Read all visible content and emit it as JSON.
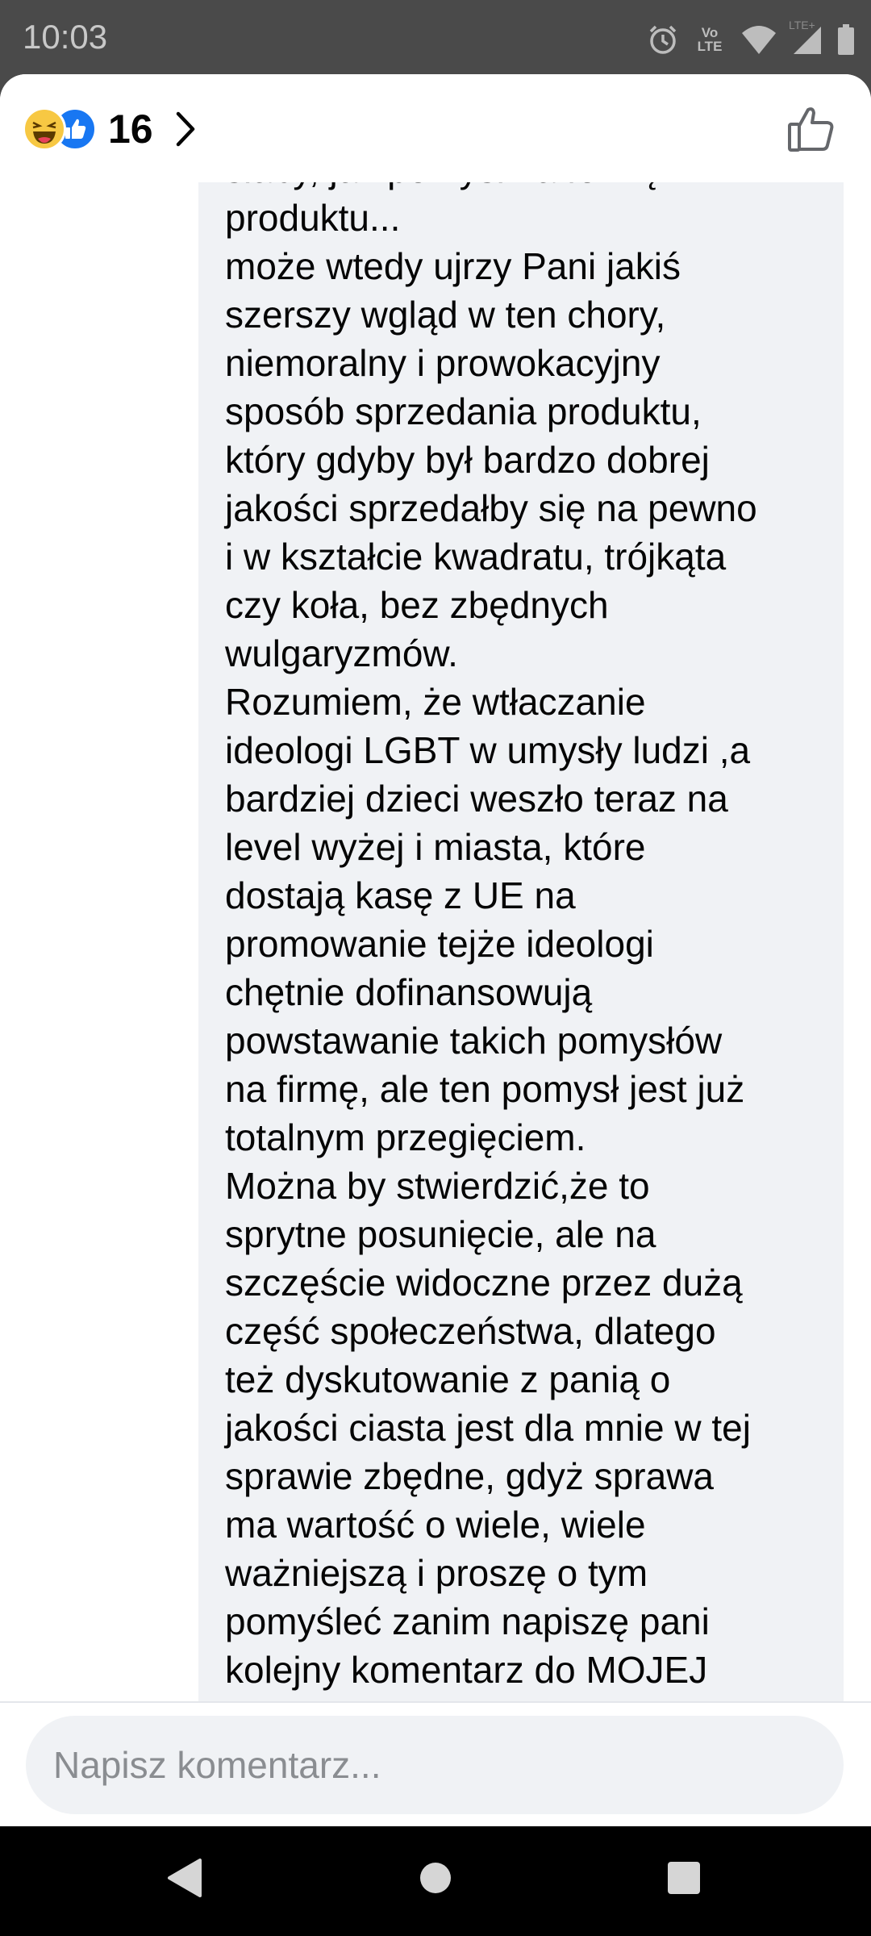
{
  "status_bar": {
    "time": "10:03",
    "icons": [
      "alarm-icon",
      "volte-icon",
      "wifi-icon",
      "signal-icon",
      "battery-icon"
    ],
    "volte_label": "Vo LTE",
    "lte_label": "LTE+"
  },
  "header": {
    "reaction_icons": [
      "haha-icon",
      "like-icon"
    ],
    "reaction_count": "16",
    "like_button_icon": "thumbs-up-icon"
  },
  "comment": {
    "lines": [
      "słaby, jak pomysł na formę",
      "produktu...",
      "może wtedy ujrzy Pani jakiś",
      "szerszy wgląd w ten chory,",
      "niemoralny i prowokacyjny",
      "sposób sprzedania produktu,",
      "który gdyby był bardzo dobrej",
      "jakości sprzedałby się na pewno",
      "i w kształcie kwadratu, trójkąta",
      "czy koła, bez zbędnych",
      "wulgaryzmów.",
      "Rozumiem, że wtłaczanie",
      "ideologi LGBT w umysły ludzi ,a",
      "bardziej dzieci weszło teraz na",
      "level wyżej i miasta, które",
      "dostają kasę z UE na",
      "promowanie tejże ideologi",
      "chętnie dofinansowują",
      "powstawanie takich pomysłów",
      "na firmę, ale ten pomysł jest już",
      "totalnym przegięciem.",
      "Można by stwierdzić,że to",
      "sprytne posunięcie, ale na",
      "szczęście widoczne przez dużą",
      "część społeczeństwa, dlatego",
      "też dyskutowanie z panią o",
      "jakości ciasta jest dla mnie w tej",
      "sprawie zbędne, gdyż sprawa",
      "ma wartość o wiele, wiele",
      "ważniejszą i proszę o tym",
      "pomyśleć zanim napiszę pani",
      "kolejny komentarz do MOJEJ"
    ]
  },
  "composer": {
    "placeholder": "Napisz komentarz..."
  },
  "nav_bar": {
    "buttons": [
      "back-icon",
      "home-icon",
      "recents-icon"
    ]
  },
  "colors": {
    "status_bar_bg": "#4a4a4a",
    "bubble_bg": "#f0f2f5",
    "like_blue": "#1877f2",
    "haha_yellow": "#f7c843",
    "text": "#050505"
  }
}
